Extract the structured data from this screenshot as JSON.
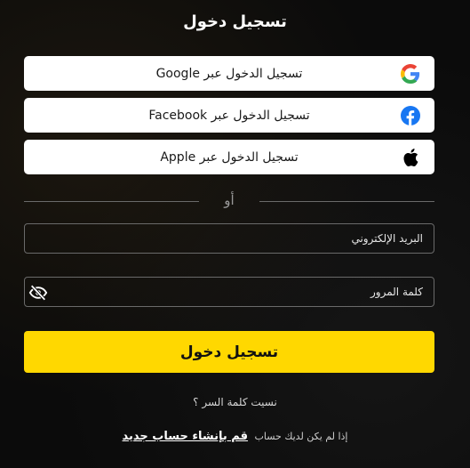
{
  "title": "تسجيل دخول",
  "social": [
    {
      "label": "تسجيل الدخول عبر Google",
      "icon": "google-icon"
    },
    {
      "label": "تسجيل الدخول عبر Facebook",
      "icon": "facebook-icon"
    },
    {
      "label": "تسجيل الدخول عبر Apple",
      "icon": "apple-icon"
    }
  ],
  "divider_text": "أو",
  "email": {
    "placeholder": "البريد الإلكتروني",
    "value": ""
  },
  "password": {
    "placeholder": "كلمة المرور",
    "value": ""
  },
  "submit_label": "تسجيل دخول",
  "forgot_label": "نسيت كلمة السر ؟",
  "signup": {
    "prompt": "إذا لم يكن لديك حساب",
    "link": "قم بإنشاء حساب جديد"
  },
  "colors": {
    "accent": "#ffd800",
    "background": "#0b0b0b",
    "facebook": "#1877f2"
  }
}
